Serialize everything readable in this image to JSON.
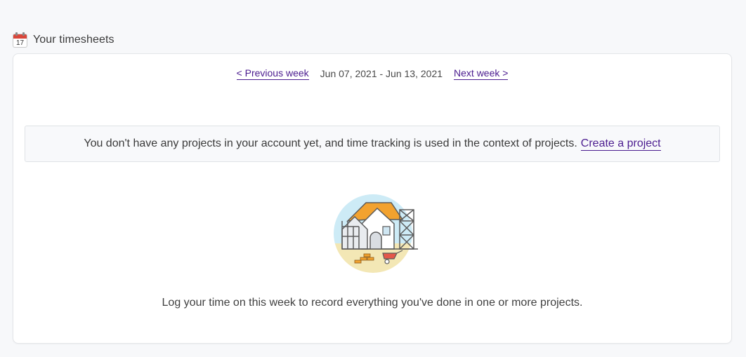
{
  "header": {
    "icon": "calendar-icon",
    "calendar_day": "17",
    "title": "Your timesheets"
  },
  "week_nav": {
    "previous_label": "< Previous week",
    "range": "Jun 07, 2021 - Jun 13, 2021",
    "next_label": "Next week >"
  },
  "notice": {
    "message": "You don't have any projects in your account yet, and time tracking is used in the context of projects.",
    "link_label": "Create a project"
  },
  "empty_state": {
    "illustration": "house-construction-illustration",
    "message": "Log your time on this week to record everything you've done in one or more projects."
  },
  "colors": {
    "link": "#4b1c8f",
    "roof": "#f2a22f",
    "sky": "#cdebf6",
    "ground": "#f3e7b5"
  }
}
